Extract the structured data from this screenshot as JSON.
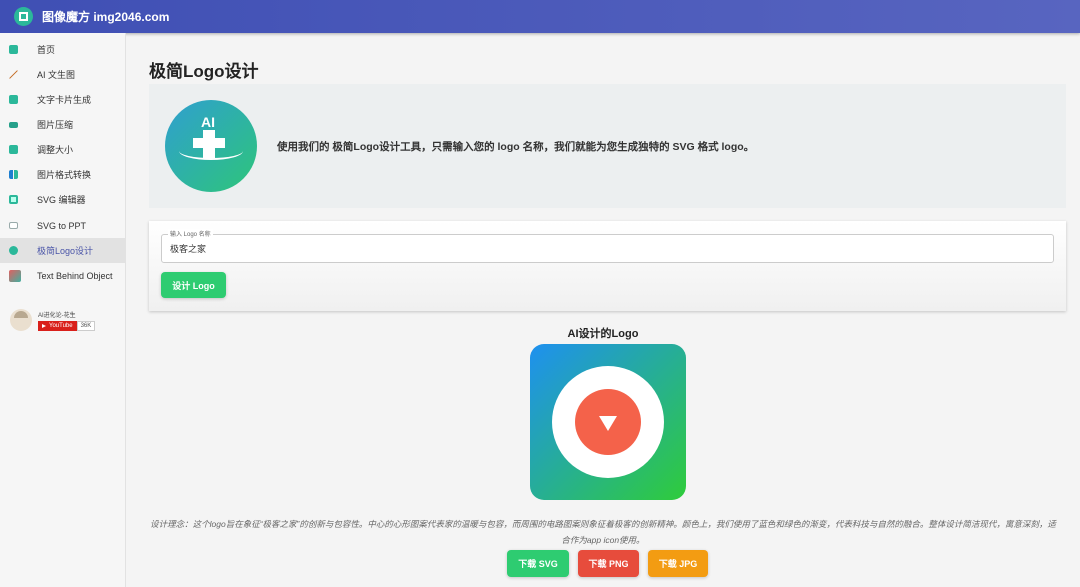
{
  "header": {
    "title": "图像魔方 img2046.com"
  },
  "sidebar": {
    "items": [
      {
        "label": "首页",
        "color": "#2bb89a"
      },
      {
        "label": "AI 文生图",
        "color": "#c97a3a"
      },
      {
        "label": "文字卡片生成",
        "color": "#2bb89a"
      },
      {
        "label": "图片压缩",
        "color": "#26a08a"
      },
      {
        "label": "调整大小",
        "color": "#2bb89a"
      },
      {
        "label": "图片格式转换",
        "color": "#1e7fd0"
      },
      {
        "label": "SVG 编辑器",
        "color": "#2bb89a"
      },
      {
        "label": "SVG to PPT",
        "color": "#9aa"
      },
      {
        "label": "极简Logo设计",
        "color": "#2bb89a"
      },
      {
        "label": "Text Behind Object",
        "color": "#d06060"
      }
    ],
    "promo": {
      "name": "AI进化论-花生",
      "youtube": "YouTube",
      "count": "36K"
    }
  },
  "main": {
    "title": "极简Logo设计",
    "hero_text": "使用我们的 极简Logo设计工具，只需输入您的 logo 名称，我们就能为您生成独特的 SVG 格式 logo。",
    "hero_logo_text": "AI",
    "input_label": "输入 Logo 名称",
    "input_value": "极客之家",
    "design_button": "设计 Logo",
    "result_title": "AI设计的Logo",
    "description": "设计理念：这个logo旨在象征“极客之家”的创新与包容性。中心的心形图案代表家的温暖与包容，而周围的电路图案则象征着极客的创新精神。颜色上，我们使用了蓝色和绿色的渐变，代表科技与自然的融合。整体设计简洁现代，寓意深刻，适合作为app icon使用。",
    "downloads": [
      {
        "label": "下载 SVG",
        "color": "#2ecc71"
      },
      {
        "label": "下载 PNG",
        "color": "#e74c3c"
      },
      {
        "label": "下载 JPG",
        "color": "#f39c12"
      }
    ]
  }
}
